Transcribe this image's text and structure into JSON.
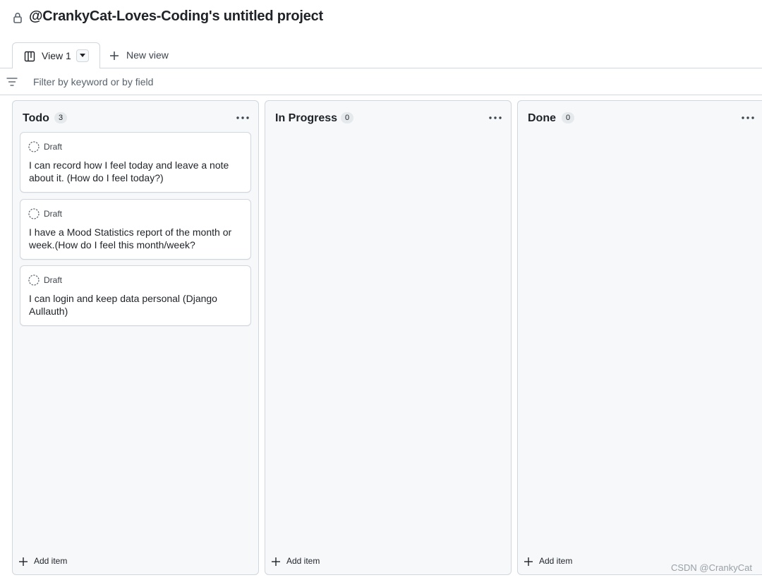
{
  "project": {
    "title": "@CrankyCat-Loves-Coding's untitled project",
    "lock_icon": "lock-icon"
  },
  "tabs": {
    "active_tab_label": "View 1",
    "new_view_label": "New view"
  },
  "filter": {
    "placeholder": "Filter by keyword or by field",
    "value": ""
  },
  "columns": [
    {
      "title": "Todo",
      "count": "3",
      "add_label": "Add item",
      "cards": [
        {
          "status": "Draft",
          "title": "I can record how I feel today and leave a note about it. (How do I feel today?)"
        },
        {
          "status": "Draft",
          "title": "I have a Mood Statistics report of the month or week.(How do I feel this month/week?"
        },
        {
          "status": "Draft",
          "title": "I can login and keep data personal (Django Aullauth)"
        }
      ]
    },
    {
      "title": "In Progress",
      "count": "0",
      "add_label": "Add item",
      "cards": []
    },
    {
      "title": "Done",
      "count": "0",
      "add_label": "Add item",
      "cards": []
    }
  ],
  "watermark": "CSDN @CrankyCat",
  "colors": {
    "border": "#d0d7de",
    "column_bg": "#f6f8fa",
    "text": "#1f2328",
    "muted": "#59636e"
  }
}
